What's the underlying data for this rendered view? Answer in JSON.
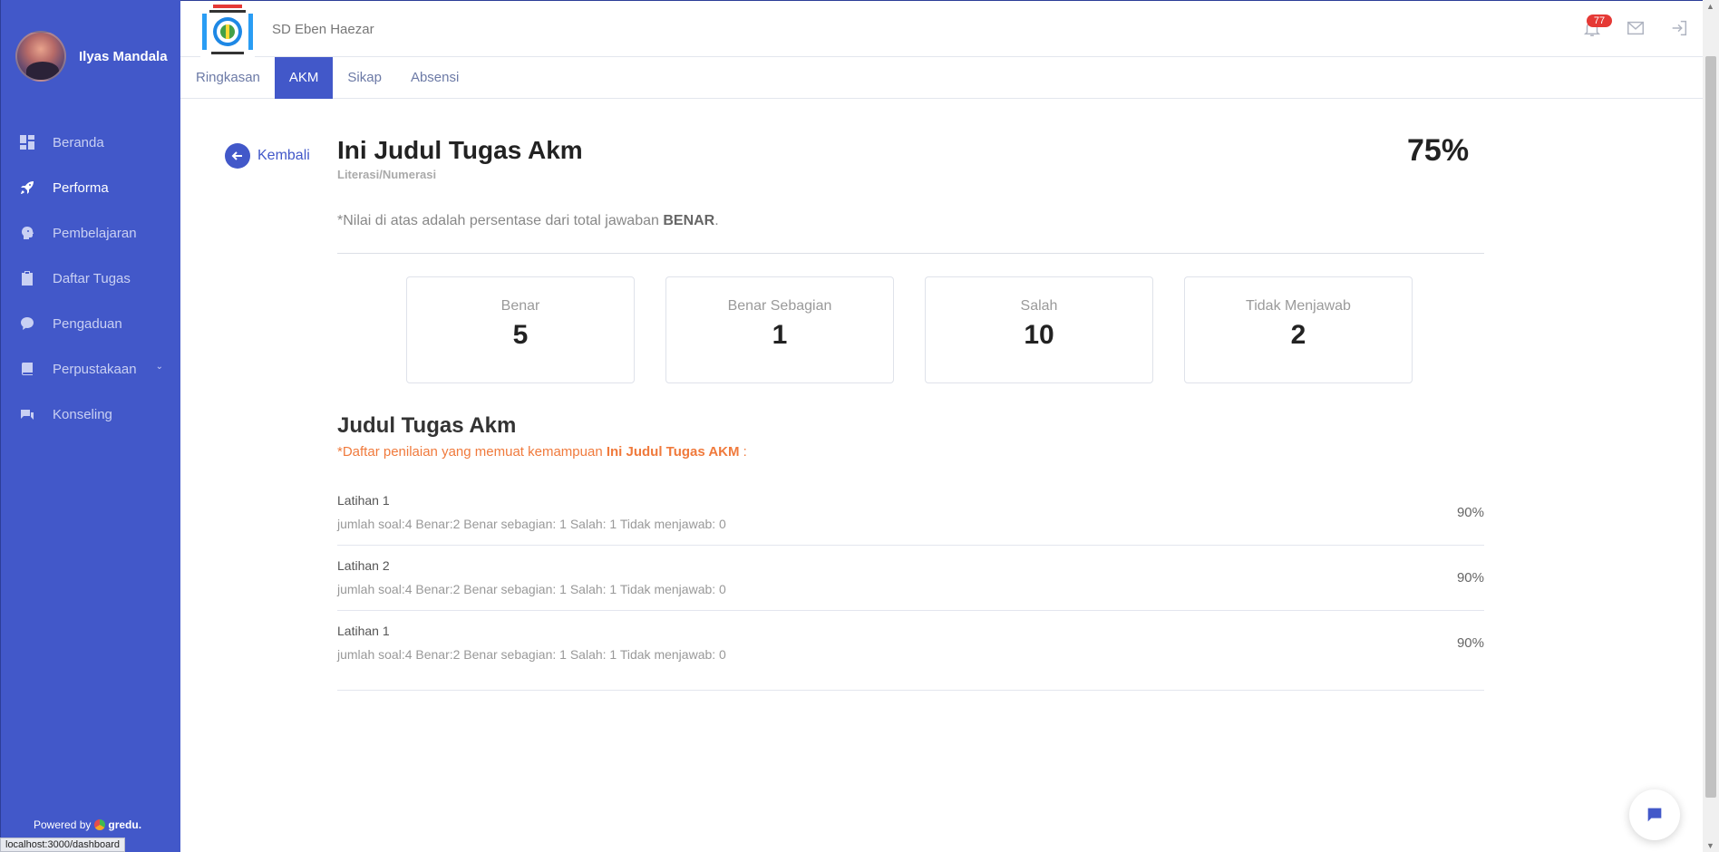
{
  "sidebar": {
    "user_name": "Ilyas Mandala",
    "items": [
      {
        "label": "Beranda",
        "icon": "dashboard-icon"
      },
      {
        "label": "Performa",
        "icon": "rocket-icon"
      },
      {
        "label": "Pembelajaran",
        "icon": "brain-icon"
      },
      {
        "label": "Daftar Tugas",
        "icon": "clipboard-icon"
      },
      {
        "label": "Pengaduan",
        "icon": "chat-bubble-icon"
      },
      {
        "label": "Perpustakaan",
        "icon": "book-icon"
      },
      {
        "label": "Konseling",
        "icon": "message-icon"
      }
    ],
    "active_item": "Performa",
    "powered_label": "Powered by",
    "powered_brand": "gredu."
  },
  "status_bar": {
    "url": "localhost:3000/dashboard"
  },
  "header": {
    "school_name": "SD Eben Haezar",
    "notification_count": "77",
    "accent_color": "#4258c9"
  },
  "tabs": [
    {
      "label": "Ringkasan"
    },
    {
      "label": "AKM"
    },
    {
      "label": "Sikap"
    },
    {
      "label": "Absensi"
    }
  ],
  "active_tab": "AKM",
  "main": {
    "back_label": "Kembali",
    "title": "Ini Judul Tugas Akm",
    "subtitle": "Literasi/Numerasi",
    "score": "75%",
    "note_prefix": "*Nilai di atas adalah persentase dari total jawaban ",
    "note_highlight": "BENAR",
    "note_suffix": ".",
    "stats": [
      {
        "label": "Benar",
        "value": "5"
      },
      {
        "label": "Benar Sebagian",
        "value": "1"
      },
      {
        "label": "Salah",
        "value": "10"
      },
      {
        "label": "Tidak Menjawab",
        "value": "2"
      }
    ],
    "section_title": "Judul Tugas Akm",
    "section_desc_prefix": "*Daftar penilaian yang memuat kemampuan ",
    "section_desc_highlight": "Ini Judul Tugas AKM",
    "section_desc_suffix": " :",
    "section_desc_color": "#f07a3c",
    "latihan": [
      {
        "name": "Latihan 1",
        "detail": "jumlah soal:4 Benar:2 Benar sebagian: 1 Salah: 1 Tidak menjawab: 0",
        "percent": "90%"
      },
      {
        "name": "Latihan 2",
        "detail": "jumlah soal:4 Benar:2 Benar sebagian: 1 Salah: 1 Tidak menjawab: 0",
        "percent": "90%"
      },
      {
        "name": "Latihan 1",
        "detail": "jumlah soal:4 Benar:2 Benar sebagian: 1 Salah: 1 Tidak menjawab: 0",
        "percent": "90%"
      }
    ]
  }
}
